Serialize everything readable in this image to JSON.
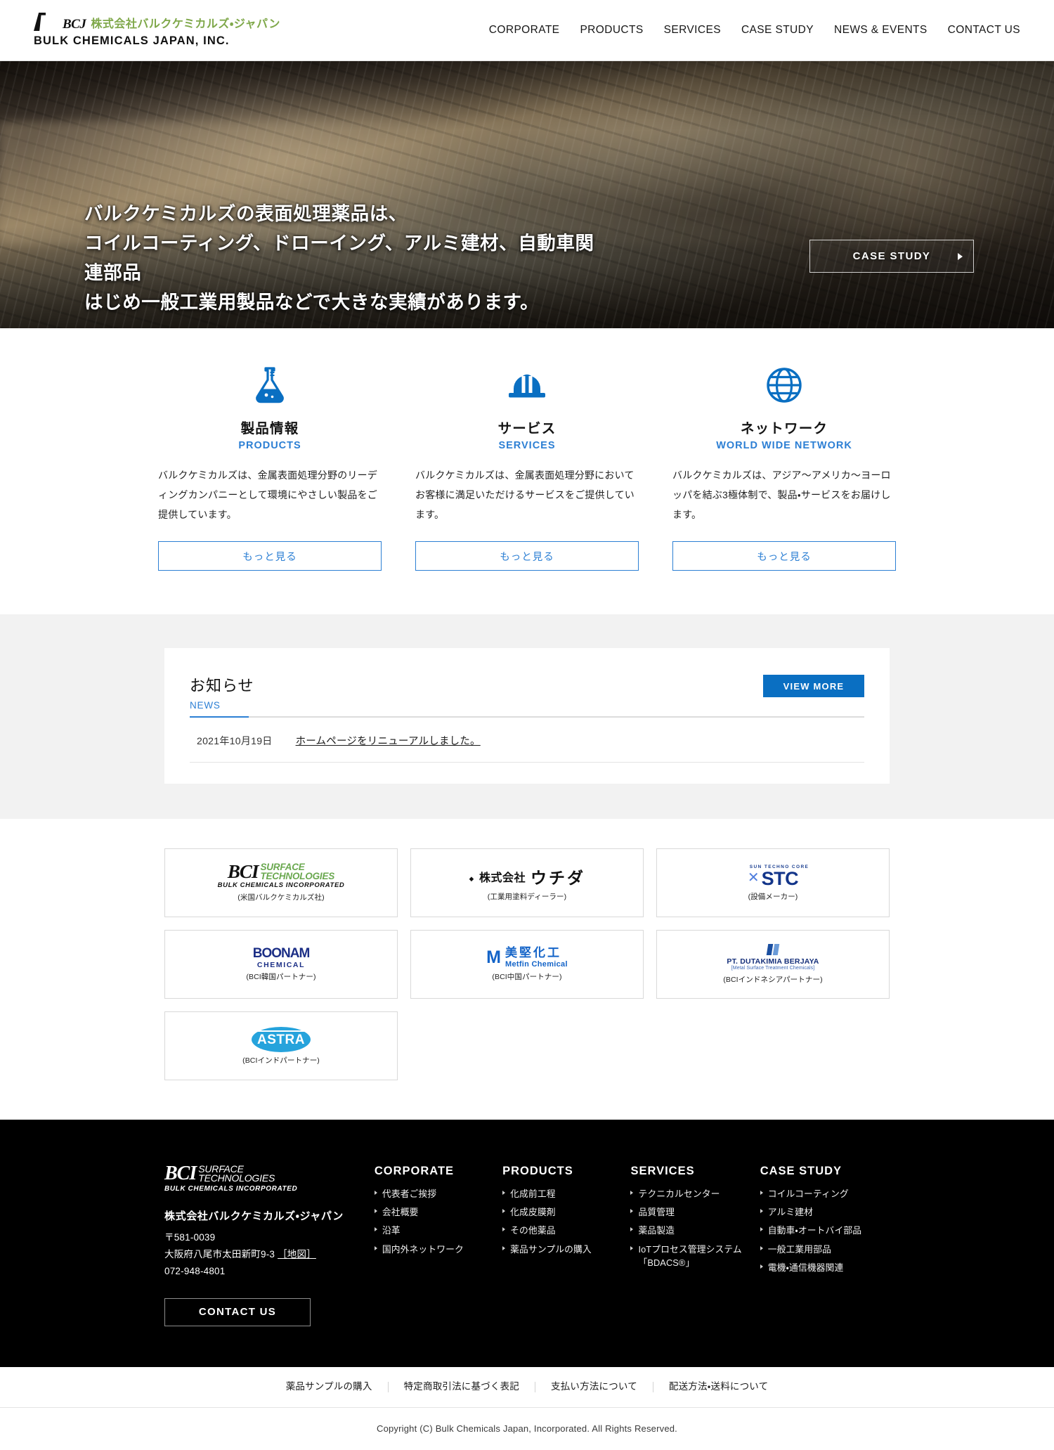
{
  "header": {
    "logo": {
      "mark": "bcj-logo-mark",
      "abbr": "BCJ",
      "company_jp": "株式会社バルクケミカルズ・ジャパン",
      "company_en": "BULK CHEMICALS JAPAN, INC."
    },
    "nav": [
      {
        "label": "CORPORATE",
        "name": "nav-corporate"
      },
      {
        "label": "PRODUCTS",
        "name": "nav-products"
      },
      {
        "label": "SERVICES",
        "name": "nav-services"
      },
      {
        "label": "CASE STUDY",
        "name": "nav-case-study"
      },
      {
        "label": "NEWS & EVENTS",
        "name": "nav-news-events"
      },
      {
        "label": "CONTACT US",
        "name": "nav-contact-us"
      }
    ]
  },
  "hero": {
    "line1": "バルクケミカルズの表面処理薬品は、",
    "line2": "コイルコーティング、ドローイング、アルミ建材、自動車関",
    "line3": "連部品",
    "line4": "はじめ一般工業用製品などで大きな実績があります。",
    "cta_label": "CASE STUDY",
    "cta_icon": "arrow-right-icon"
  },
  "features": [
    {
      "icon": "flask-icon",
      "title": "製品情報",
      "subtitle": "PRODUCTS",
      "desc": "バルクケミカルズは、金属表面処理分野のリーディングカンパニーとして環境にやさしい製品をご提供しています。",
      "button": "もっと見る"
    },
    {
      "icon": "hard-hat-icon",
      "title": "サービス",
      "subtitle": "SERVICES",
      "desc": "バルクケミカルズは、金属表面処理分野においてお客様に満足いただけるサービスをご提供しています。",
      "button": "もっと見る"
    },
    {
      "icon": "globe-icon",
      "title": "ネットワーク",
      "subtitle": "WORLD WIDE NETWORK",
      "desc": "バルクケミカルズは、アジア〜アメリカ〜ヨーロッパを結ぶ3極体制で、製品・サービスをお届けします。",
      "button": "もっと見る"
    }
  ],
  "news": {
    "title": "お知らせ",
    "subtitle": "NEWS",
    "view_more": "VIEW MORE",
    "items": [
      {
        "date": "2021年10月19日",
        "text": "ホームページをリニューアルしました。"
      }
    ]
  },
  "partners": [
    {
      "logo": "bci-surface-technologies-logo",
      "caption": "(米国バルクケミカルズ社)",
      "bci_b": "BCI",
      "bci_s1": "SURFACE",
      "bci_s2": "TECHNOLOGIES",
      "bci_bottom": "BULK CHEMICALS INCORPORATED"
    },
    {
      "logo": "uchida-logo",
      "caption": "(工業用塗料ディーラー)",
      "mark": "𝆺",
      "kanji": "株式会社",
      "kana": "ウチダ"
    },
    {
      "logo": "stc-logo",
      "caption": "(設備メーカー)",
      "tagline": "SUN TECHNO CORE",
      "main": "STC"
    },
    {
      "logo": "boonam-chemical-logo",
      "caption": "(BCI韓国パートナー)",
      "t1": "BOONAM",
      "t2": "CHEMICAL"
    },
    {
      "logo": "metfin-chemical-logo",
      "caption": "(BCI中国パートナー)",
      "mark": "M",
      "jp": "美堅化工",
      "en": "Metfin Chemical"
    },
    {
      "logo": "pt-dutakimia-berjaya-logo",
      "caption": "(BCIインドネシアパートナー)",
      "name": "PT. DUTAKIMIA BERJAYA",
      "sub": "[Metal Surface Treatment Chemicals]"
    },
    {
      "logo": "astra-logo",
      "caption": "(BCIインドパートナー)",
      "name": "ASTRA"
    }
  ],
  "footer": {
    "logo": {
      "b": "BCI",
      "s1": "SURFACE",
      "s2": "TECHNOLOGIES",
      "bottom": "BULK CHEMICALS INCORPORATED"
    },
    "company": "株式会社バルクケミカルズ・ジャパン",
    "postal": "〒581-0039",
    "address": "大阪府八尾市太田新町9-3",
    "map_label": "［地図］",
    "phone": "072-948-4801",
    "contact_button": "CONTACT US",
    "columns": [
      {
        "title": "CORPORATE",
        "items": [
          "代表者ご挨拶",
          "会社概要",
          "沿革",
          "国内外ネットワーク"
        ]
      },
      {
        "title": "PRODUCTS",
        "items": [
          "化成前工程",
          "化成皮膜剤",
          "その他薬品",
          "薬品サンプルの購入"
        ]
      },
      {
        "title": "SERVICES",
        "items": [
          "テクニカルセンター",
          "品質管理",
          "薬品製造",
          "IoTプロセス管理システム「BDACS®」"
        ]
      },
      {
        "title": "CASE STUDY",
        "items": [
          "コイルコーティング",
          "アルミ建材",
          "自動車・オートバイ部品",
          "一般工業用部品",
          "電機・通信機器関連"
        ]
      }
    ]
  },
  "bottom": {
    "links": [
      "薬品サンプルの購入",
      "特定商取引法に基づく表記",
      "支払い方法について",
      "配送方法・送料について"
    ],
    "copyright": "Copyright (C) Bulk Chemicals Japan, Incorporated. All Rights Reserved."
  },
  "colors": {
    "accent_blue": "#2c7fd4",
    "button_blue": "#0a6fc2",
    "logo_green": "#7fa84a",
    "footer_bg": "#000000"
  }
}
